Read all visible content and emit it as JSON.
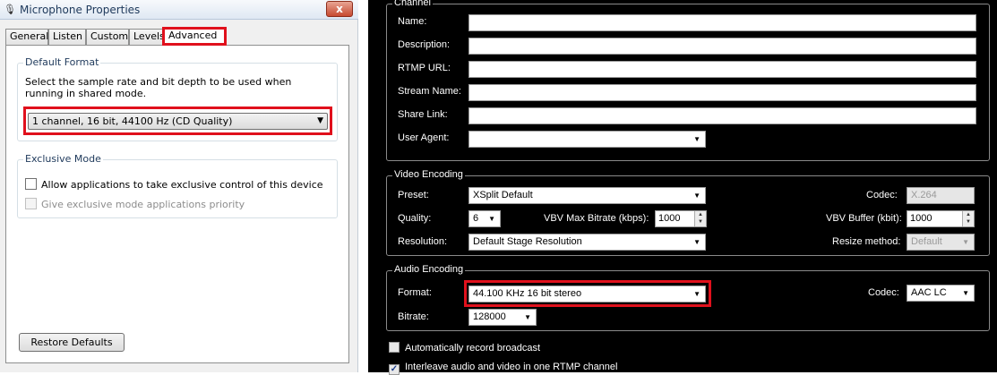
{
  "left": {
    "window": {
      "title": "Microphone Properties",
      "close_label": "x"
    },
    "tabs": [
      "General",
      "Listen",
      "Custom",
      "Levels",
      "Advanced"
    ],
    "active_tab": "Advanced",
    "default_format": {
      "group_title": "Default Format",
      "description": "Select the sample rate and bit depth to be used when running in shared mode.",
      "selected_value": "1 channel, 16 bit, 44100 Hz (CD Quality)"
    },
    "exclusive_mode": {
      "group_title": "Exclusive Mode",
      "allow_label": "Allow applications to take exclusive control of this device",
      "allow_checked": false,
      "priority_label": "Give exclusive mode applications priority",
      "priority_enabled": false
    },
    "restore_button": "Restore Defaults"
  },
  "right": {
    "channel": {
      "title": "Channel",
      "fields": [
        {
          "label": "Name:",
          "value": ""
        },
        {
          "label": "Description:",
          "value": ""
        },
        {
          "label": "RTMP URL:",
          "value": ""
        },
        {
          "label": "Stream Name:",
          "value": ""
        },
        {
          "label": "Share Link:",
          "value": ""
        }
      ],
      "user_agent_label": "User Agent:",
      "user_agent_value": ""
    },
    "video": {
      "title": "Video Encoding",
      "preset_label": "Preset:",
      "preset_value": "XSplit Default",
      "codec_label": "Codec:",
      "codec_value": "X.264",
      "quality_label": "Quality:",
      "quality_value": "6",
      "vbv_max_label": "VBV Max Bitrate (kbps):",
      "vbv_max_value": "1000",
      "vbv_buffer_label": "VBV Buffer (kbit):",
      "vbv_buffer_value": "1000",
      "resolution_label": "Resolution:",
      "resolution_value": "Default Stage Resolution",
      "resize_label": "Resize method:",
      "resize_value": "Default"
    },
    "audio": {
      "title": "Audio Encoding",
      "format_label": "Format:",
      "format_value": "44.100 KHz 16 bit stereo",
      "codec_label": "Codec:",
      "codec_value": "AAC LC",
      "bitrate_label": "Bitrate:",
      "bitrate_value": "128000"
    },
    "auto_record_label": "Automatically record broadcast",
    "auto_record_checked": false,
    "interleave_label": "Interleave audio and video in one RTMP channel",
    "interleave_checked": true
  },
  "colors": {
    "highlight": "#e0101c",
    "dialog_bg": "#f0f0f0",
    "dark_bg": "#000000"
  }
}
